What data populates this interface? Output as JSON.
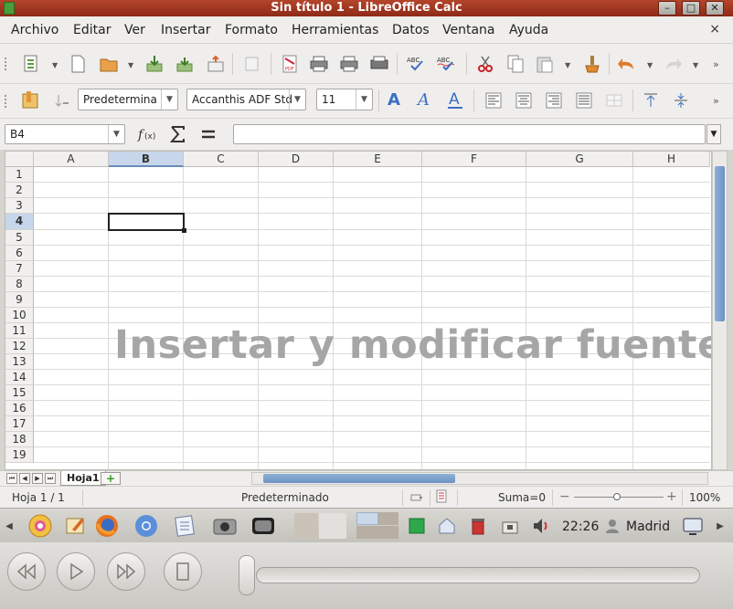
{
  "window": {
    "title": "Sin título 1 - LibreOffice Calc",
    "minimize_label": "–",
    "maximize_label": "□",
    "close_label": "✕"
  },
  "menubar": {
    "items": [
      "Archivo",
      "Editar",
      "Ver",
      "Insertar",
      "Formato",
      "Herramientas",
      "Datos",
      "Ventana",
      "Ayuda"
    ],
    "close_label": "×"
  },
  "toolbar_formatting": {
    "paragraph_style": "Predetermina",
    "font_name": "Accanthis ADF Std",
    "font_size": "11"
  },
  "formula_bar": {
    "name_box": "B4",
    "formula": ""
  },
  "grid": {
    "columns": [
      "A",
      "B",
      "C",
      "D",
      "E",
      "F",
      "G",
      "H"
    ],
    "rows": [
      "1",
      "2",
      "3",
      "4",
      "5",
      "6",
      "7",
      "8",
      "9",
      "10",
      "11",
      "12",
      "13",
      "14",
      "15",
      "16",
      "17",
      "18",
      "19"
    ],
    "active_column": "B",
    "active_row": "4"
  },
  "overlay": {
    "caption": "Insertar y modificar fuente"
  },
  "sheets": {
    "tabs": [
      "Hoja1"
    ],
    "add_label": "+"
  },
  "statusbar": {
    "sheet_position": "Hoja 1 / 1",
    "page_style": "Predeterminado",
    "sum": "Suma=0",
    "zoom_minus": "−",
    "zoom_plus": "+",
    "zoom": "100%"
  },
  "taskbar": {
    "clock": "22:26",
    "user": "Madrid"
  },
  "colors": {
    "titlebar": "#9c3420",
    "accent": "#6d92c4",
    "watermark": "#a6a6a6"
  }
}
